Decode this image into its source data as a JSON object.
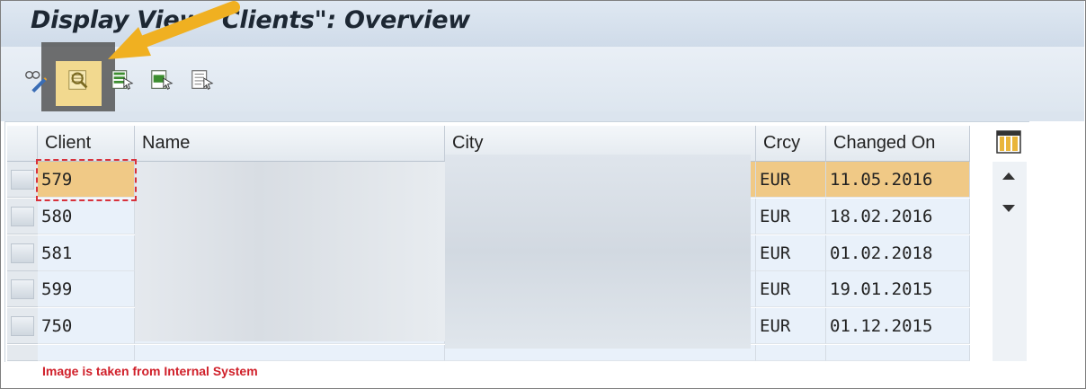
{
  "window": {
    "title": "Display View \"Clients\": Overview"
  },
  "toolbar": {
    "buttons": [
      {
        "icon": "glasses-pencil-icon"
      },
      {
        "icon": "details-icon"
      },
      {
        "icon": "select-all-icon"
      },
      {
        "icon": "select-block-icon"
      },
      {
        "icon": "deselect-all-icon"
      }
    ]
  },
  "table": {
    "columns": [
      "Client",
      "Name",
      "City",
      "Crcy",
      "Changed On"
    ],
    "rows": [
      {
        "client": "579",
        "crcy": "EUR",
        "changed_on": "11.05.2016",
        "selected": true
      },
      {
        "client": "580",
        "crcy": "EUR",
        "changed_on": "18.02.2016",
        "selected": false
      },
      {
        "client": "581",
        "crcy": "EUR",
        "changed_on": "01.02.2018",
        "selected": false
      },
      {
        "client": "599",
        "crcy": "EUR",
        "changed_on": "19.01.2015",
        "selected": false
      },
      {
        "client": "750",
        "crcy": "EUR",
        "changed_on": "01.12.2015",
        "selected": false
      }
    ]
  },
  "footer_note": "Image is taken from Internal System"
}
